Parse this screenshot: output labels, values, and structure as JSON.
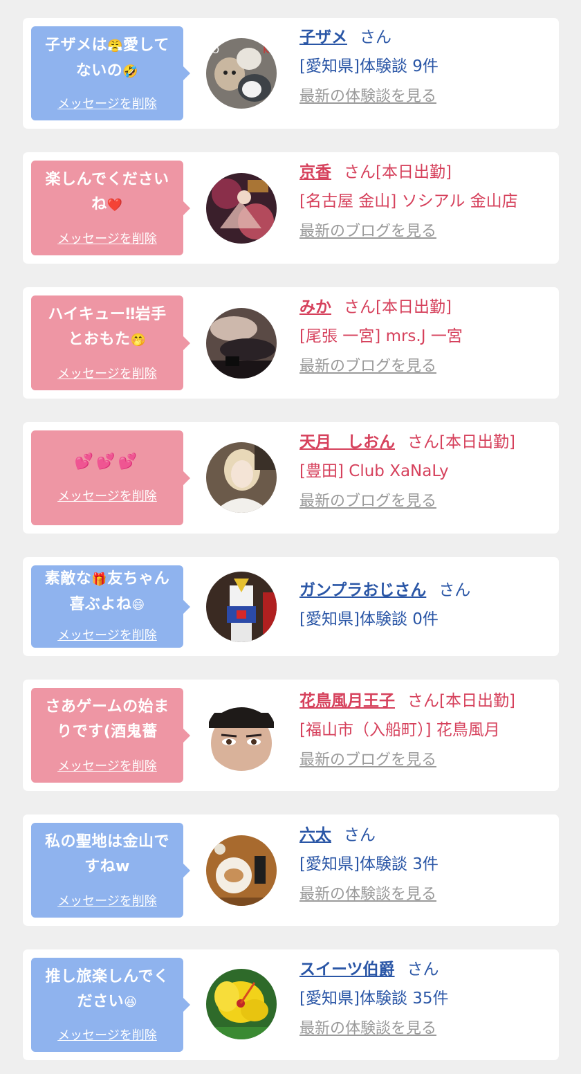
{
  "delete_label": "メッセージを削除",
  "san_label": "さん",
  "items": [
    {
      "type": "customer",
      "bubble_lines": [
        "子ザメは",
        "愛して",
        "ないの"
      ],
      "emojis": [
        "😤",
        "🤣"
      ],
      "name": "子ザメ",
      "status": "",
      "line2": "[愛知県]体験談 9件",
      "link": "最新の体験談を見る"
    },
    {
      "type": "cast",
      "bubble_lines": [
        "楽しんでください",
        "ね"
      ],
      "emojis": [
        "❤️"
      ],
      "name": "京香",
      "status": "[本日出勤]",
      "line2": "[名古屋 金山] ソシアル 金山店",
      "link": "最新のブログを見る"
    },
    {
      "type": "cast",
      "bubble_lines": [
        "ハイキュー‼岩手",
        "とおもた"
      ],
      "emojis": [
        "🤭"
      ],
      "name": "みか",
      "status": "[本日出勤]",
      "line2": "[尾張 一宮] mrs.J 一宮",
      "link": "最新のブログを見る"
    },
    {
      "type": "cast",
      "bubble_lines": [
        ""
      ],
      "emojis": [
        "💕💕💕"
      ],
      "name": "天月　しおん",
      "status": "[本日出勤]",
      "line2": "[豊田] Club XaNaLy",
      "link": "最新のブログを見る"
    },
    {
      "type": "customer",
      "bubble_lines": [
        "素敵な",
        "友ちゃん",
        "喜ぶよね"
      ],
      "emojis": [
        "🎁",
        "😄"
      ],
      "name": "ガンプラおじさん",
      "status": "",
      "line2": "[愛知県]体験談 0件",
      "link": ""
    },
    {
      "type": "cast",
      "bubble_lines": [
        "さあゲームの始ま",
        "りです(酒鬼薔"
      ],
      "emojis": [],
      "name": "花鳥風月王子",
      "status": "[本日出勤]",
      "line2": "[福山市（入船町）] 花鳥風月",
      "link": "最新のブログを見る"
    },
    {
      "type": "customer",
      "bubble_lines": [
        "私の聖地は金山で",
        "すねw"
      ],
      "emojis": [],
      "name": "六太",
      "status": "",
      "line2": "[愛知県]体験談 3件",
      "link": "最新の体験談を見る"
    },
    {
      "type": "customer",
      "bubble_lines": [
        "推し旅楽しんでく",
        "ださい"
      ],
      "emojis": [
        "😆"
      ],
      "name": "スイーツ伯爵",
      "status": "",
      "line2": "[愛知県]体験談 35件",
      "link": "最新の体験談を見る"
    }
  ],
  "colors": {
    "page_background": "#efefef",
    "card_background": "#ffffff",
    "customer_bubble": "#8fb3ee",
    "cast_bubble": "#ee96a4",
    "customer_text": "#2a56a6",
    "cast_text": "#d6415c",
    "link_gray": "#9a9a9a"
  },
  "avatars": [
    "cartoon-animals-photo",
    "kimono-fan-photo",
    "legs-stockings-photo",
    "blonde-woman-photo",
    "gundam-model-photo",
    "man-face-photo",
    "food-plate-photo",
    "yellow-hibiscus-photo"
  ]
}
